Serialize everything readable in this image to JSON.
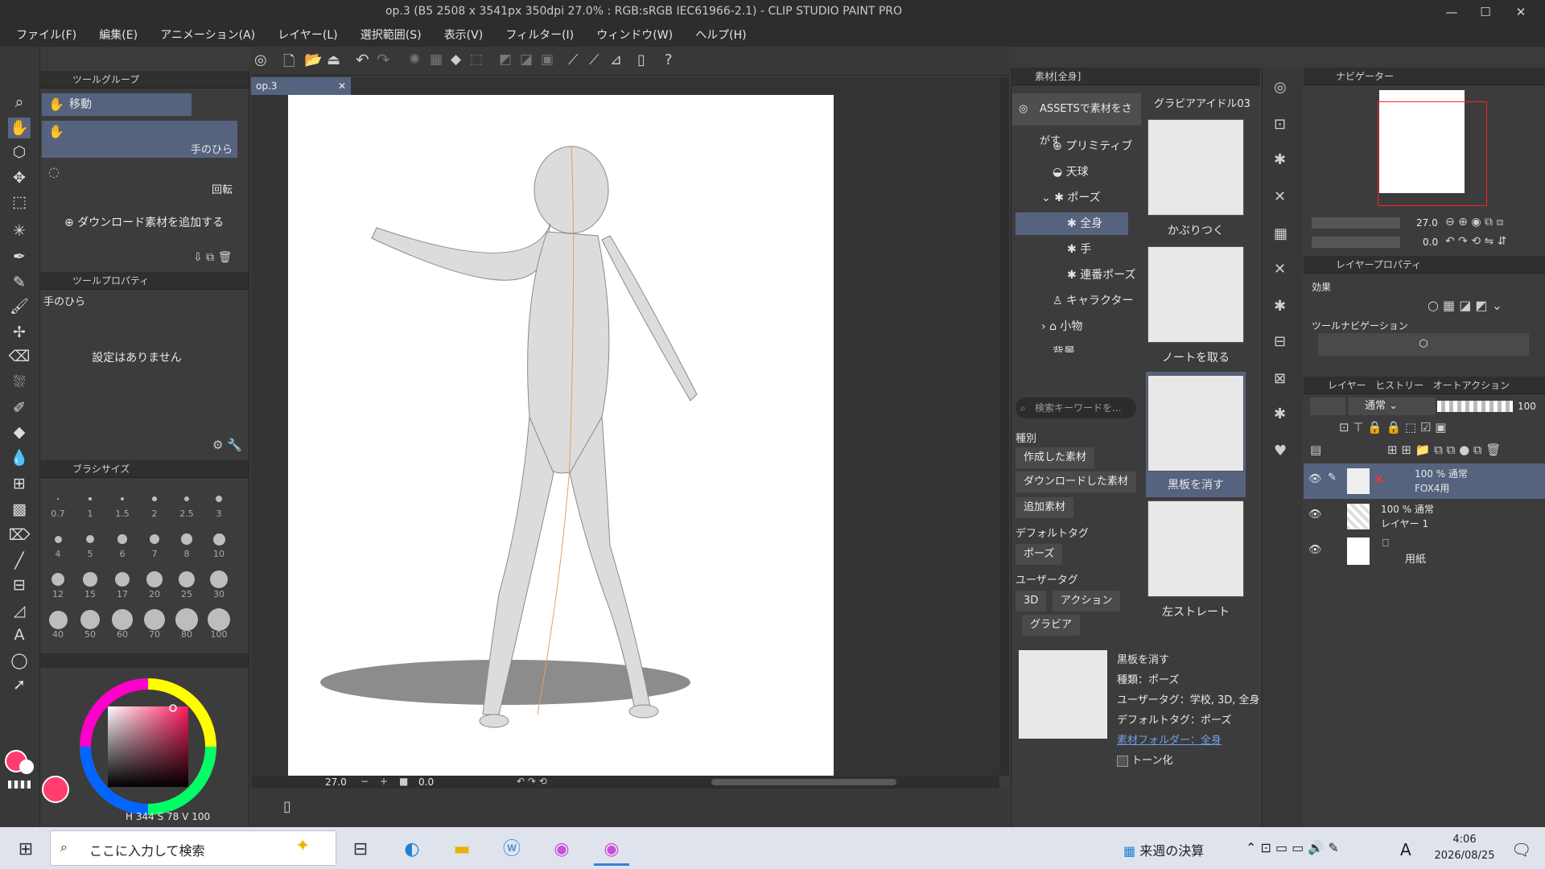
{
  "window": {
    "title": "op.3 (B5 2508 x 3541px 350dpi 27.0% : RGB:sRGB IEC61966-2.1)  - CLIP STUDIO PAINT PRO",
    "minimize": "—",
    "maximize": "☐",
    "close": "✕"
  },
  "menu": [
    "ファイル(F)",
    "編集(E)",
    "アニメーション(A)",
    "レイヤー(L)",
    "選択範囲(S)",
    "表示(V)",
    "フィルター(I)",
    "ウィンドウ(W)",
    "ヘルプ(H)"
  ],
  "tool_group": {
    "header": "ツールグループ",
    "items": [
      {
        "label": "移動",
        "icon": "hand-icon"
      }
    ],
    "sub_tools": [
      {
        "label": "手のひら",
        "icon": "hand-icon"
      },
      {
        "label": "回転",
        "icon": "rotate-icon"
      }
    ],
    "add_download": "ダウンロード素材を追加する"
  },
  "tool_property": {
    "header": "ツールプロパティ",
    "tool_name": "手のひら",
    "empty_text": "設定はありません"
  },
  "brush_size": {
    "header": "ブラシサイズ",
    "sizes": [
      "0.7",
      "1",
      "1.5",
      "2",
      "2.5",
      "3",
      "4",
      "5",
      "6",
      "7",
      "8",
      "10",
      "12",
      "15",
      "17",
      "20",
      "25",
      "30",
      "40",
      "50",
      "60",
      "70",
      "80",
      "100"
    ]
  },
  "color": {
    "main": "#ff3d6e",
    "hsv_label_h": "H",
    "hsv_h": "344",
    "hsv_label_s": "S",
    "hsv_s": "78",
    "hsv_label_v": "V",
    "hsv_v": "100"
  },
  "document": {
    "tab": "op.3",
    "zoom": "27.0",
    "rotation": "0.0"
  },
  "material": {
    "header": "素材[全身]",
    "assets_button": "ASSETSで素材をさがす",
    "folder_title": "グラビアアイドル03",
    "tree": [
      {
        "label": "プリミティブ"
      },
      {
        "label": "天球"
      },
      {
        "label": "ポーズ"
      },
      {
        "label": "全身"
      },
      {
        "label": "手"
      },
      {
        "label": "連番ポーズ"
      },
      {
        "label": "キャラクター"
      },
      {
        "label": "小物"
      },
      {
        "label": "背景"
      }
    ],
    "search_placeholder": "検索キーワードを...",
    "section_type": "種別",
    "type_tags": [
      "作成した素材",
      "ダウンロードした素材",
      "追加素材"
    ],
    "section_default_tag": "デフォルトタグ",
    "default_tags": [
      "ポーズ"
    ],
    "section_user_tag": "ユーザータグ",
    "user_tags": [
      "3D",
      "アクション",
      "グラビア"
    ],
    "thumbnails": [
      "かぶりつく",
      "ノートを取る",
      "黒板を消す",
      "左ストレート"
    ],
    "detail": {
      "name": "黒板を消す",
      "type": "種類：ポーズ",
      "user_tags": "ユーザータグ：学校, 3D, 全身",
      "default_tags": "デフォルトタグ：ポーズ",
      "folder_link": "素材フォルダー：全身",
      "tone": "トーン化"
    }
  },
  "navigator": {
    "header": "ナビゲーター",
    "zoom": "27.0",
    "angle": "0.0"
  },
  "layer_property": {
    "header": "レイヤープロパティ",
    "effect": "効果",
    "tool_navigation": "ツールナビゲーション"
  },
  "layers": {
    "tabs": [
      "レイヤー",
      "ヒストリー",
      "オートアクション"
    ],
    "blend_mode": "通常",
    "opacity": "100",
    "rows": [
      {
        "mode": "100 % 通常",
        "name": "FOX4用",
        "active": true
      },
      {
        "mode": "100 % 通常",
        "name": "レイヤー 1",
        "active": false
      },
      {
        "mode": "",
        "name": "用紙",
        "active": false
      }
    ]
  },
  "taskbar": {
    "search_placeholder": "ここに入力して検索",
    "widget": "来週の決算",
    "ime": "A",
    "time": "4:06",
    "date": "2026/08/25"
  }
}
